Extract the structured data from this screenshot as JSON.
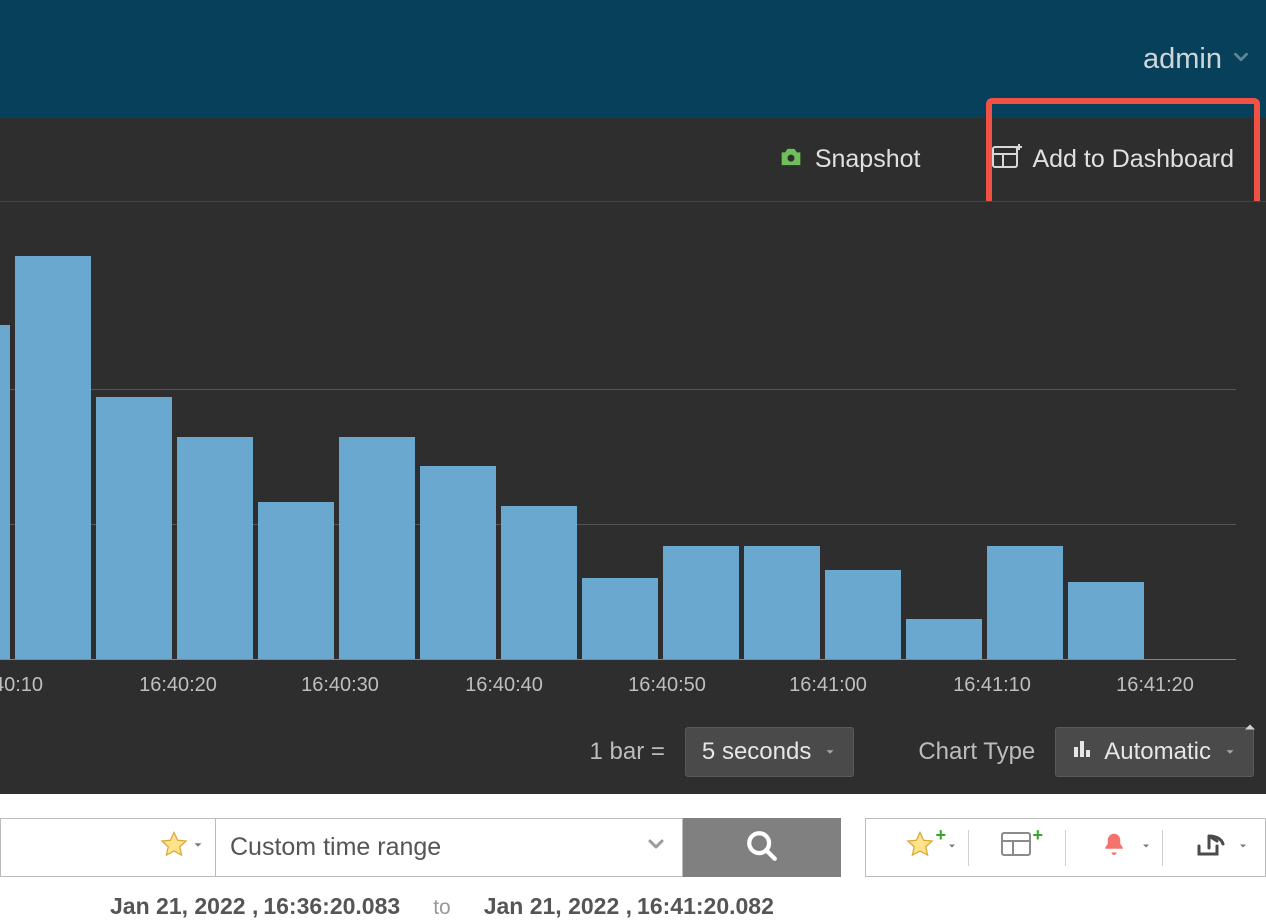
{
  "header": {
    "user_label": "admin"
  },
  "toolbar": {
    "snapshot_label": "Snapshot",
    "add_to_dashboard_label": "Add to Dashboard"
  },
  "chart_data": {
    "type": "bar",
    "title": "",
    "xlabel": "",
    "ylabel": "",
    "ylim": [
      0,
      10
    ],
    "x_ticks": [
      "40:10",
      "16:40:20",
      "16:40:30",
      "16:40:40",
      "16:40:50",
      "16:41:00",
      "16:41:10",
      "16:41:20"
    ],
    "categories": [
      "16:40:07",
      "16:40:12",
      "16:40:17",
      "16:40:22",
      "16:40:27",
      "16:40:32",
      "16:40:37",
      "16:40:42",
      "16:40:47",
      "16:40:52",
      "16:40:57",
      "16:41:02",
      "16:41:07",
      "16:41:12",
      "16:41:17"
    ],
    "values": [
      8.3,
      10.0,
      6.5,
      5.5,
      3.9,
      5.5,
      4.8,
      3.8,
      2.0,
      2.8,
      2.8,
      2.2,
      1.0,
      2.8,
      1.9
    ]
  },
  "chart_footer": {
    "bar_equals_prefix": "1 bar =",
    "bar_interval_label": "5 seconds",
    "chart_type_prefix": "Chart Type",
    "chart_type_value": "Automatic"
  },
  "lower": {
    "time_range_label": "Custom time range",
    "from_day": "Jan 21, 2022 ,",
    "from_time": "16:36:20.083",
    "to_label": "to",
    "to_day": "Jan 21, 2022 ,",
    "to_time": "16:41:20.082"
  }
}
